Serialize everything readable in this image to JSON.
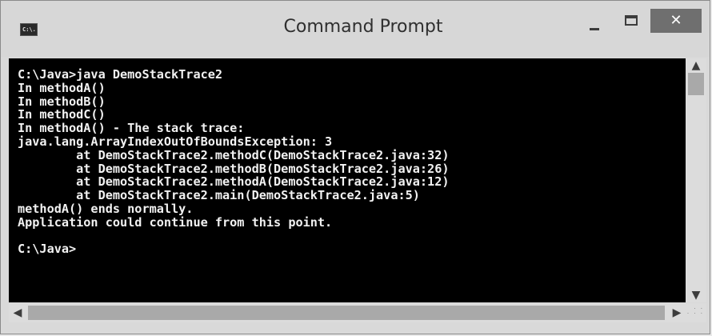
{
  "window": {
    "title": "Command Prompt",
    "icon": "console-icon",
    "icon_text": "C:\\.",
    "controls": {
      "minimize_icon": "minimize-icon",
      "maximize_icon": "maximize-icon",
      "close_label": "✕"
    }
  },
  "console": {
    "background": "#000000",
    "foreground": "#f2f2f2",
    "text": "C:\\Java>java DemoStackTrace2\nIn methodA()\nIn methodB()\nIn methodC()\nIn methodA() - The stack trace:\njava.lang.ArrayIndexOutOfBoundsException: 3\n        at DemoStackTrace2.methodC(DemoStackTrace2.java:32)\n        at DemoStackTrace2.methodB(DemoStackTrace2.java:26)\n        at DemoStackTrace2.methodA(DemoStackTrace2.java:12)\n        at DemoStackTrace2.main(DemoStackTrace2.java:5)\nmethodA() ends normally.\nApplication could continue from this point.\n\nC:\\Java>"
  },
  "scrollbars": {
    "up_arrow": "▲",
    "down_arrow": "▼",
    "left_arrow": "◀",
    "right_arrow": "▶",
    "grip": ". .\n. . ."
  }
}
